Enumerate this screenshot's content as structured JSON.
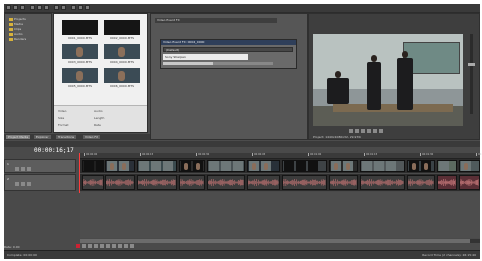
{
  "explorer": {
    "tree_items": [
      "Projects",
      "Media",
      "Clips",
      "Audio",
      "Renders"
    ]
  },
  "media": {
    "items": [
      {
        "name": "0001_0000.MTS"
      },
      {
        "name": "0002_0000.MTS"
      },
      {
        "name": "0003_0000.MTS"
      },
      {
        "name": "0004_0000.MTS"
      },
      {
        "name": "0005_0000.MTS"
      },
      {
        "name": "0006_0000.MTS"
      }
    ],
    "props": [
      "Video",
      "Audio",
      "Size",
      "Length",
      "Format",
      "Rate"
    ]
  },
  "tabs": [
    "Project Media",
    "Explorer",
    "Transitions",
    "Video FX"
  ],
  "fx": {
    "header": "Video Event FX",
    "dialog_title": "Video Event FX: 0004_0000",
    "preset": "(Default)",
    "plugin": "Sony Sharpen",
    "amount": 0.45
  },
  "preview": {
    "info": "Project: 1440x1080x32, 29.970i",
    "volume_level": 0.62
  },
  "timeline": {
    "timecode": "00:00:16;17",
    "ruler_labels": [
      "00:00:00",
      "00:00:15",
      "00:00:30",
      "00:00:45",
      "00:01:00",
      "00:01:15",
      "00:01:30",
      "00:01:45"
    ],
    "video_track_num": "1",
    "audio_track_num": "2",
    "rate": "Rate: 0.00"
  },
  "status": {
    "left": "Complete: 00:00:00",
    "right": "Record Time (2 channels): 26:15:40"
  }
}
